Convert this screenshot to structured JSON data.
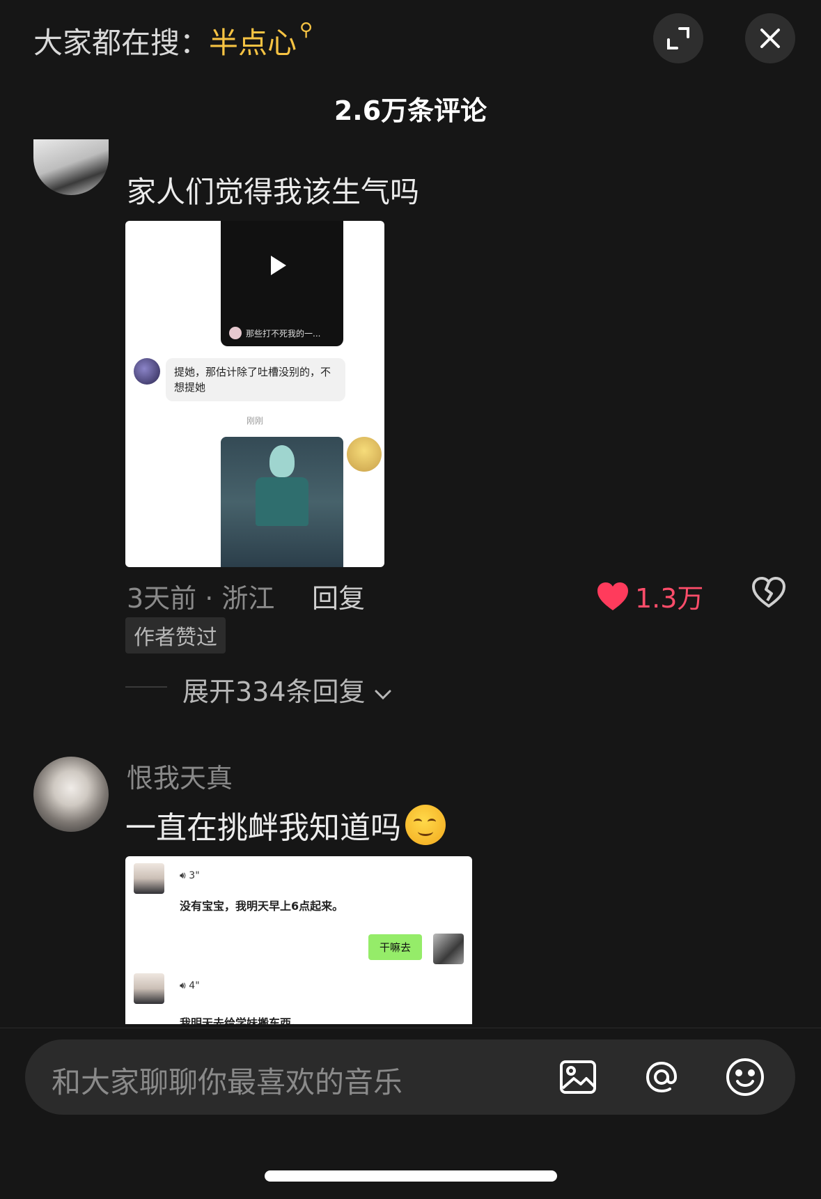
{
  "header": {
    "search_prefix": "大家都在搜：",
    "search_keyword": "半点心",
    "expand_icon": "expand-icon",
    "close_icon": "close-icon",
    "title": "2.6万条评论"
  },
  "comments": [
    {
      "username": "",
      "text": "家人们觉得我该生气吗",
      "image": {
        "video_caption": "那些打不死我的一...",
        "chat_bubble": "提她，那估计除了吐槽没别的，不想提她",
        "chat_time": "刚刚"
      },
      "time_location": "3天前 · 浙江",
      "reply_label": "回复",
      "like_count": "1.3万",
      "author_badge": "作者赞过",
      "expand_replies": "展开334条回复"
    },
    {
      "username": "恨我天真",
      "text": "一直在挑衅我知道吗",
      "image": {
        "voice1": "3\"",
        "line1": "没有宝宝，我明天早上6点起来。",
        "my_reply": "干嘛去",
        "voice2": "4\"",
        "line2": "我明天去给学妹搬东西。"
      }
    }
  ],
  "input": {
    "placeholder": "和大家聊聊你最喜欢的音乐",
    "icons": [
      "image-icon",
      "at-icon",
      "emoji-icon"
    ]
  },
  "colors": {
    "background": "#161616",
    "keyword": "#f6c343",
    "like": "#ff4d6a"
  }
}
